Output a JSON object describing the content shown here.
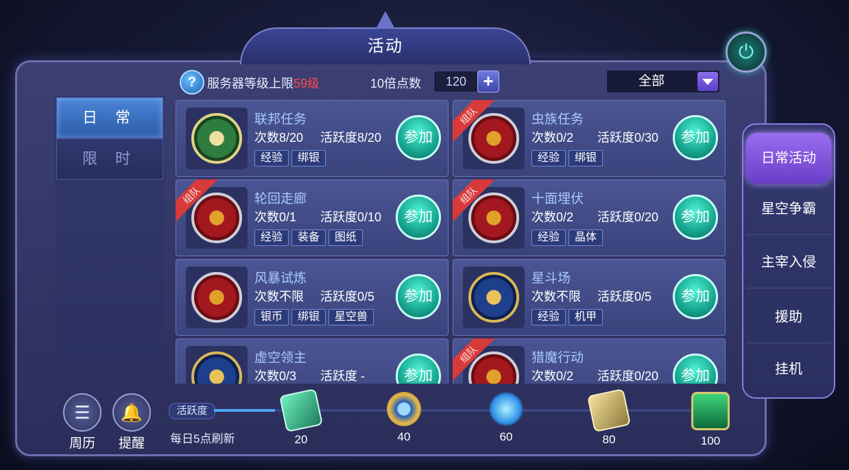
{
  "window": {
    "title": "活动"
  },
  "info": {
    "server_label": "服务器等级上限",
    "server_level": "59级",
    "multiplier_label": "10倍点数",
    "multiplier_value": "120",
    "plus_symbol": "+",
    "filter_value": "全部"
  },
  "left_tabs": [
    {
      "label": "日 常",
      "active": true
    },
    {
      "label": "限 时",
      "active": false
    }
  ],
  "activities": [
    {
      "name": "联邦任务",
      "count": "次数8/20",
      "activity": "活跃度8/20",
      "tags": [
        "经验",
        "绑银"
      ],
      "team": false,
      "emblem": "green"
    },
    {
      "name": "虫族任务",
      "count": "次数0/2",
      "activity": "活跃度0/30",
      "tags": [
        "经验",
        "绑银"
      ],
      "team": true,
      "emblem": "red"
    },
    {
      "name": "轮回走廊",
      "count": "次数0/1",
      "activity": "活跃度0/10",
      "tags": [
        "经验",
        "装备",
        "图纸"
      ],
      "team": true,
      "emblem": "red"
    },
    {
      "name": "十面埋伏",
      "count": "次数0/2",
      "activity": "活跃度0/20",
      "tags": [
        "经验",
        "晶体"
      ],
      "team": true,
      "emblem": "red"
    },
    {
      "name": "风暴试炼",
      "count": "次数不限",
      "activity": "活跃度0/5",
      "tags": [
        "银币",
        "绑银",
        "星空兽"
      ],
      "team": false,
      "emblem": "red"
    },
    {
      "name": "星斗场",
      "count": "次数不限",
      "activity": "活跃度0/5",
      "tags": [
        "经验",
        "机甲"
      ],
      "team": false,
      "emblem": "blue"
    },
    {
      "name": "虚空领主",
      "count": "次数0/3",
      "activity": "活跃度 -",
      "tags": [],
      "team": false,
      "emblem": "blue"
    },
    {
      "name": "猎魔行动",
      "count": "次数0/2",
      "activity": "活跃度0/20",
      "tags": [],
      "team": true,
      "emblem": "red"
    }
  ],
  "join_label": "参加",
  "team_label": "组队",
  "right_nav": [
    {
      "label": "日常活动",
      "active": true
    },
    {
      "label": "星空争霸",
      "active": false
    },
    {
      "label": "主宰入侵",
      "active": false
    },
    {
      "label": "援助",
      "active": false
    },
    {
      "label": "挂机",
      "active": false
    }
  ],
  "bottom": {
    "calendar_label": "周历",
    "remind_label": "提醒",
    "activity_label": "活跃度",
    "refresh_text": "每日5点刷新",
    "progress": 0.12,
    "milestones": [
      {
        "value": "20",
        "icon": "card-reward-icon"
      },
      {
        "value": "40",
        "icon": "gem-reward-icon"
      },
      {
        "value": "60",
        "icon": "crystal-reward-icon"
      },
      {
        "value": "80",
        "icon": "card-stack-reward-icon"
      },
      {
        "value": "100",
        "icon": "chest-reward-icon"
      }
    ]
  },
  "colors": {
    "level_red": "#ff4a4a",
    "join_teal": "#16a58f",
    "accent_purple": "#8b6ff0"
  }
}
